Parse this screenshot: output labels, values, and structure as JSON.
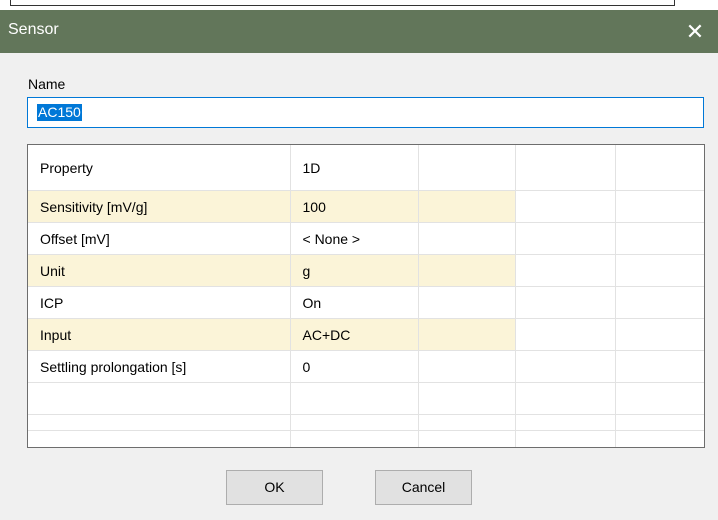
{
  "window": {
    "title": "Sensor",
    "close_glyph": "✕"
  },
  "name": {
    "label": "Name",
    "value": "AC150"
  },
  "grid": {
    "headers": [
      "Property",
      "1D",
      "",
      "",
      ""
    ],
    "rows": [
      [
        "Sensitivity [mV/g]",
        "100"
      ],
      [
        "Offset [mV]",
        "< None >"
      ],
      [
        "Unit",
        "g"
      ],
      [
        "ICP",
        "On"
      ],
      [
        "Input",
        "AC+DC"
      ],
      [
        "Settling prolongation [s]",
        "0"
      ]
    ],
    "alt_row_color": "#fbf4d8"
  },
  "buttons": {
    "ok": "OK",
    "cancel": "Cancel"
  },
  "colors": {
    "titlebar": "#62765a",
    "selection": "#0078d7"
  }
}
